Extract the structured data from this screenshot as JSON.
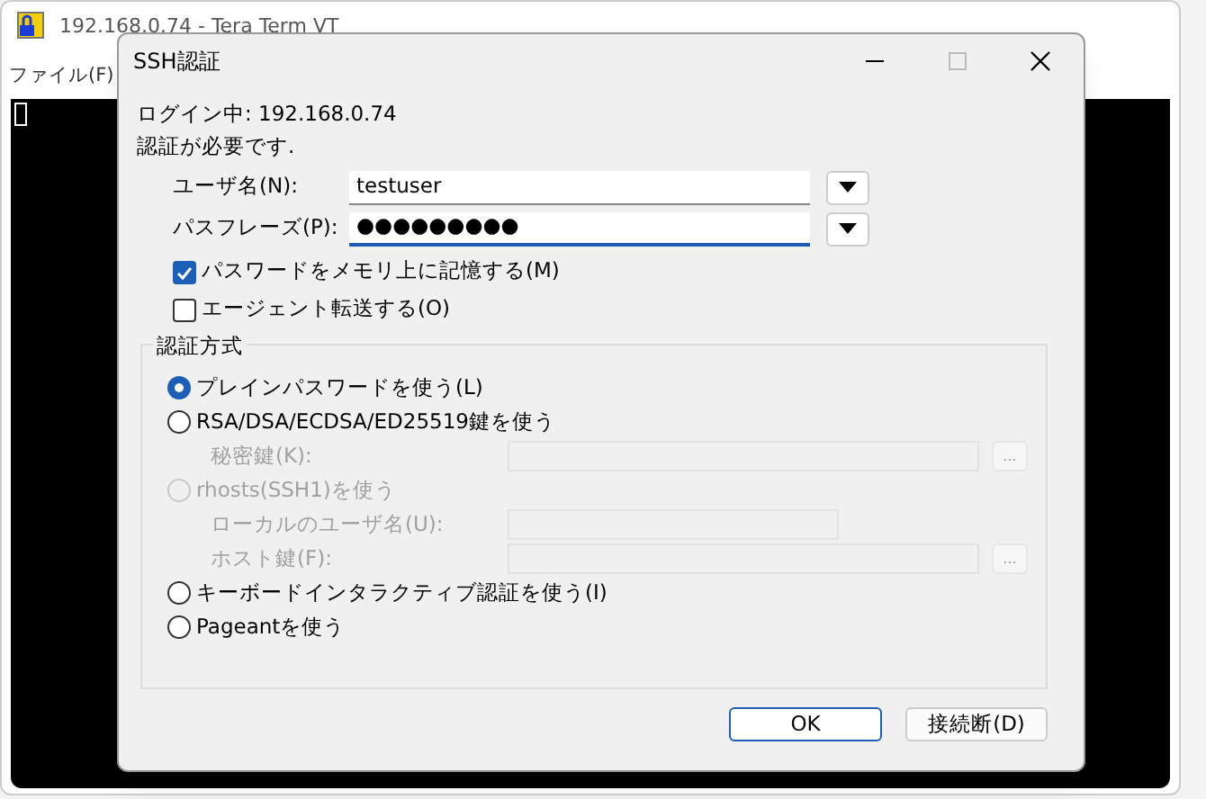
{
  "back_window": {
    "title": "192.168.0.74 - Tera Term VT",
    "menu": [
      "ファイル(F)"
    ]
  },
  "dialog": {
    "title": "SSH認証",
    "status": "ログイン中: 192.168.0.74",
    "prompt": "認証が必要です.",
    "fields": [
      {
        "label": "ユーザ名(N):",
        "value": "testuser",
        "focused": false
      },
      {
        "label": "パスフレーズ(P):",
        "value": "●●●●●●●●●",
        "focused": true
      }
    ],
    "checkboxes": [
      {
        "label": "パスワードをメモリ上に記憶する(M)",
        "checked": true
      },
      {
        "label": "エージェント転送する(O)",
        "checked": false
      }
    ],
    "group": {
      "title": "認証方式",
      "methods": [
        {
          "label": "プレインパスワードを使う(L)",
          "selected": true,
          "disabled": false
        },
        {
          "label": "RSA/DSA/ECDSA/ED25519鍵を使う",
          "selected": false,
          "disabled": false,
          "fields": [
            {
              "label": "秘密鍵(K):",
              "browse": "...",
              "kind": "long"
            }
          ]
        },
        {
          "label": "rhosts(SSH1)を使う",
          "selected": false,
          "disabled": true,
          "fields": [
            {
              "label": "ローカルのユーザ名(U):",
              "kind": "short"
            },
            {
              "label": "ホスト鍵(F):",
              "browse": "...",
              "kind": "long"
            }
          ]
        },
        {
          "label": "キーボードインタラクティブ認証を使う(I)",
          "selected": false,
          "disabled": false
        },
        {
          "label": "Pageantを使う",
          "selected": false,
          "disabled": false
        }
      ]
    },
    "buttons": [
      {
        "label": "OK",
        "default": true
      },
      {
        "label": "接続断(D)",
        "default": false
      }
    ]
  }
}
